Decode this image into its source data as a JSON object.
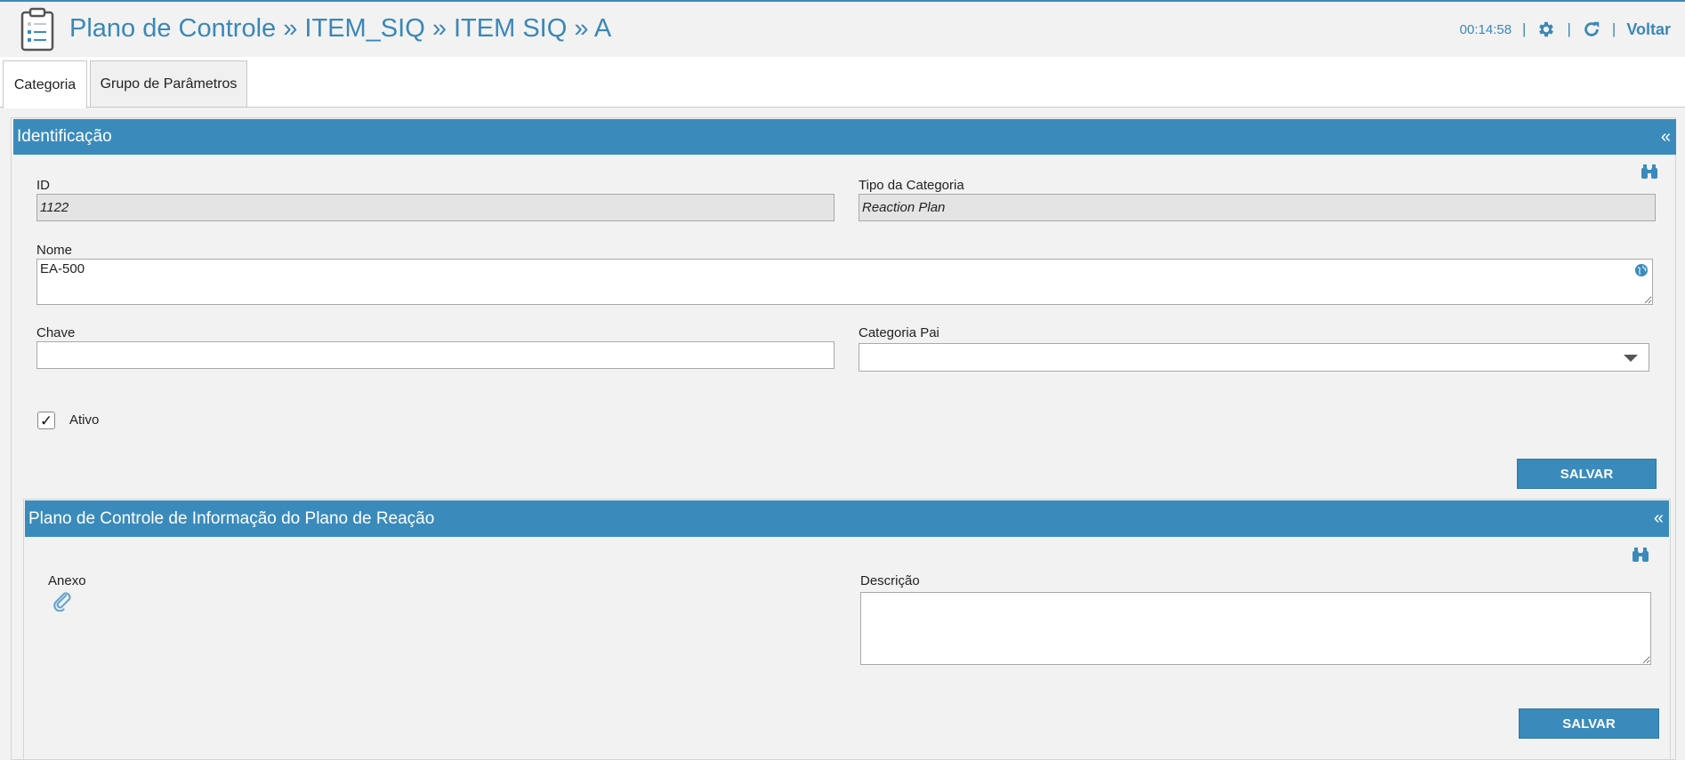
{
  "header": {
    "title": "Plano de Controle » ITEM_SIQ » ITEM SIQ » A",
    "timer": "00:14:58",
    "separator": "|",
    "back_label": "Voltar",
    "icons": [
      "clipboard-icon",
      "gear-icon",
      "refresh-icon"
    ]
  },
  "tabs": [
    {
      "label": "Categoria",
      "active": true
    },
    {
      "label": "Grupo de Parâmetros",
      "active": false
    }
  ],
  "identificacao": {
    "title": "Identificação",
    "collapse_label": "«",
    "id_label": "ID",
    "id_value": "1122",
    "tipo_label": "Tipo da Categoria",
    "tipo_value": "Reaction Plan",
    "nome_label": "Nome",
    "nome_value": "EA-500",
    "chave_label": "Chave",
    "chave_value": "",
    "categoria_pai_label": "Categoria Pai",
    "categoria_pai_value": "",
    "ativo_label": "Ativo",
    "ativo_checked": true,
    "checkmark": "✓",
    "save_label": "SALVAR"
  },
  "plano_reacao": {
    "title": "Plano de Controle de Informação do Plano de Reação",
    "collapse_label": "«",
    "anexo_label": "Anexo",
    "descricao_label": "Descrição",
    "descricao_value": "",
    "save_label": "SALVAR"
  },
  "colors": {
    "accent": "#3a8bbb",
    "title_blue": "#3a87b8",
    "readonly_bg": "#e4e4e4"
  }
}
